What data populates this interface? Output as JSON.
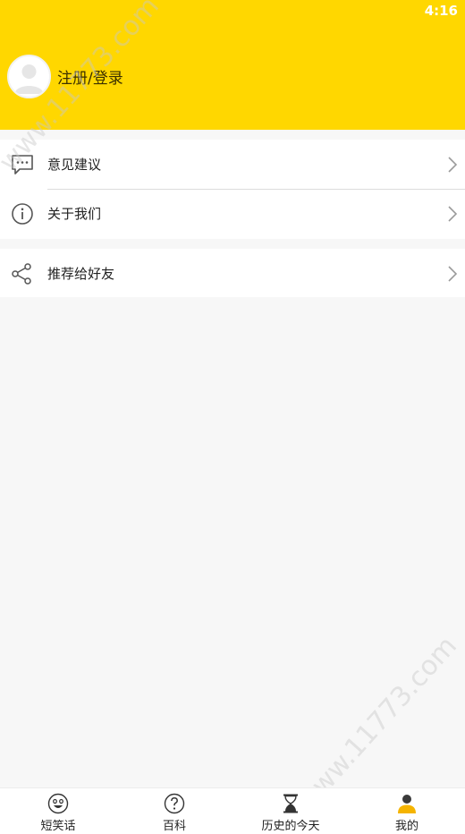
{
  "status_bar": {
    "time": "4:16"
  },
  "header": {
    "login_label": "注册/登录"
  },
  "menu": {
    "feedback": "意见建议",
    "about": "关于我们",
    "share": "推荐给好友"
  },
  "bottom_nav": [
    {
      "label": "短笑话",
      "icon": "smiley-icon"
    },
    {
      "label": "百科",
      "icon": "question-icon"
    },
    {
      "label": "历史的今天",
      "icon": "hourglass-icon"
    },
    {
      "label": "我的",
      "icon": "person-icon"
    }
  ],
  "watermark": "www.11773.com",
  "colors": {
    "header_bg": "#ffd700",
    "active_nav": "#f5b400"
  }
}
